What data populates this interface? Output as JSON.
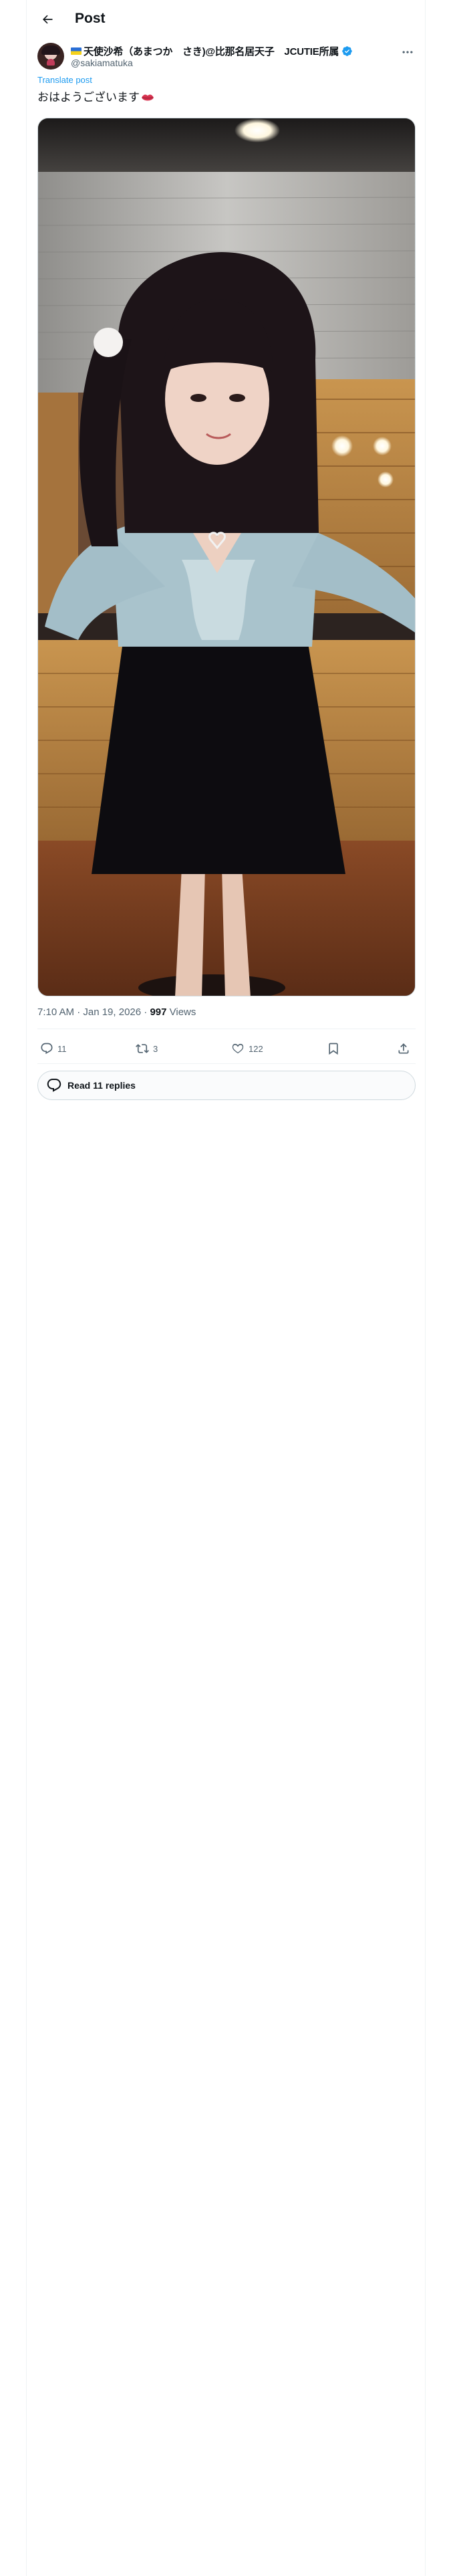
{
  "header": {
    "title": "Post"
  },
  "author": {
    "display_name": "天使沙希（あまつか　さき)@比那名居天子　JCUTIE所属",
    "handle": "@sakiamatuka",
    "verified": true
  },
  "post": {
    "translate_label": "Translate post",
    "text": "おはようございます",
    "emoji": "lips-icon"
  },
  "meta": {
    "timestamp": "7:10 AM · Jan 19, 2026 · ",
    "views_count": "997",
    "views_label": " Views"
  },
  "actions": {
    "replies": "11",
    "reposts": "3",
    "likes": "122"
  },
  "read_replies": {
    "label": "Read 11 replies"
  },
  "colors": {
    "accent": "#1d9bf0",
    "secondary_text": "#536471",
    "border": "#cfd9de"
  }
}
